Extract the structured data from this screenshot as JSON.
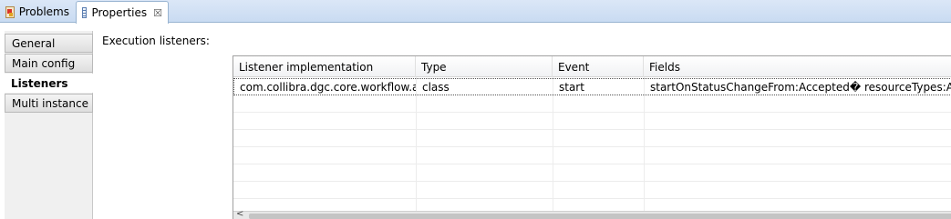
{
  "tabs": [
    {
      "label": "Problems",
      "icon": "problems-icon",
      "active": false
    },
    {
      "label": "Properties",
      "icon": "properties-icon",
      "active": true,
      "close": "☒"
    }
  ],
  "sidebar": {
    "items": [
      {
        "label": "General",
        "active": false
      },
      {
        "label": "Main config",
        "active": false
      },
      {
        "label": "Listeners",
        "active": true
      },
      {
        "label": "Multi instance",
        "active": false
      }
    ]
  },
  "main": {
    "section_label": "Execution listeners:",
    "table": {
      "columns": [
        "Listener implementation",
        "Type",
        "Event",
        "Fields"
      ],
      "rows": [
        {
          "implementation": "com.collibra.dgc.core.workflow.a...",
          "type": "class",
          "event": "start",
          "fields": "startOnStatusChangeFrom:Accepted� resourceTypes:AT"
        }
      ]
    },
    "scrollbar": {
      "left_arrow": "<"
    }
  }
}
